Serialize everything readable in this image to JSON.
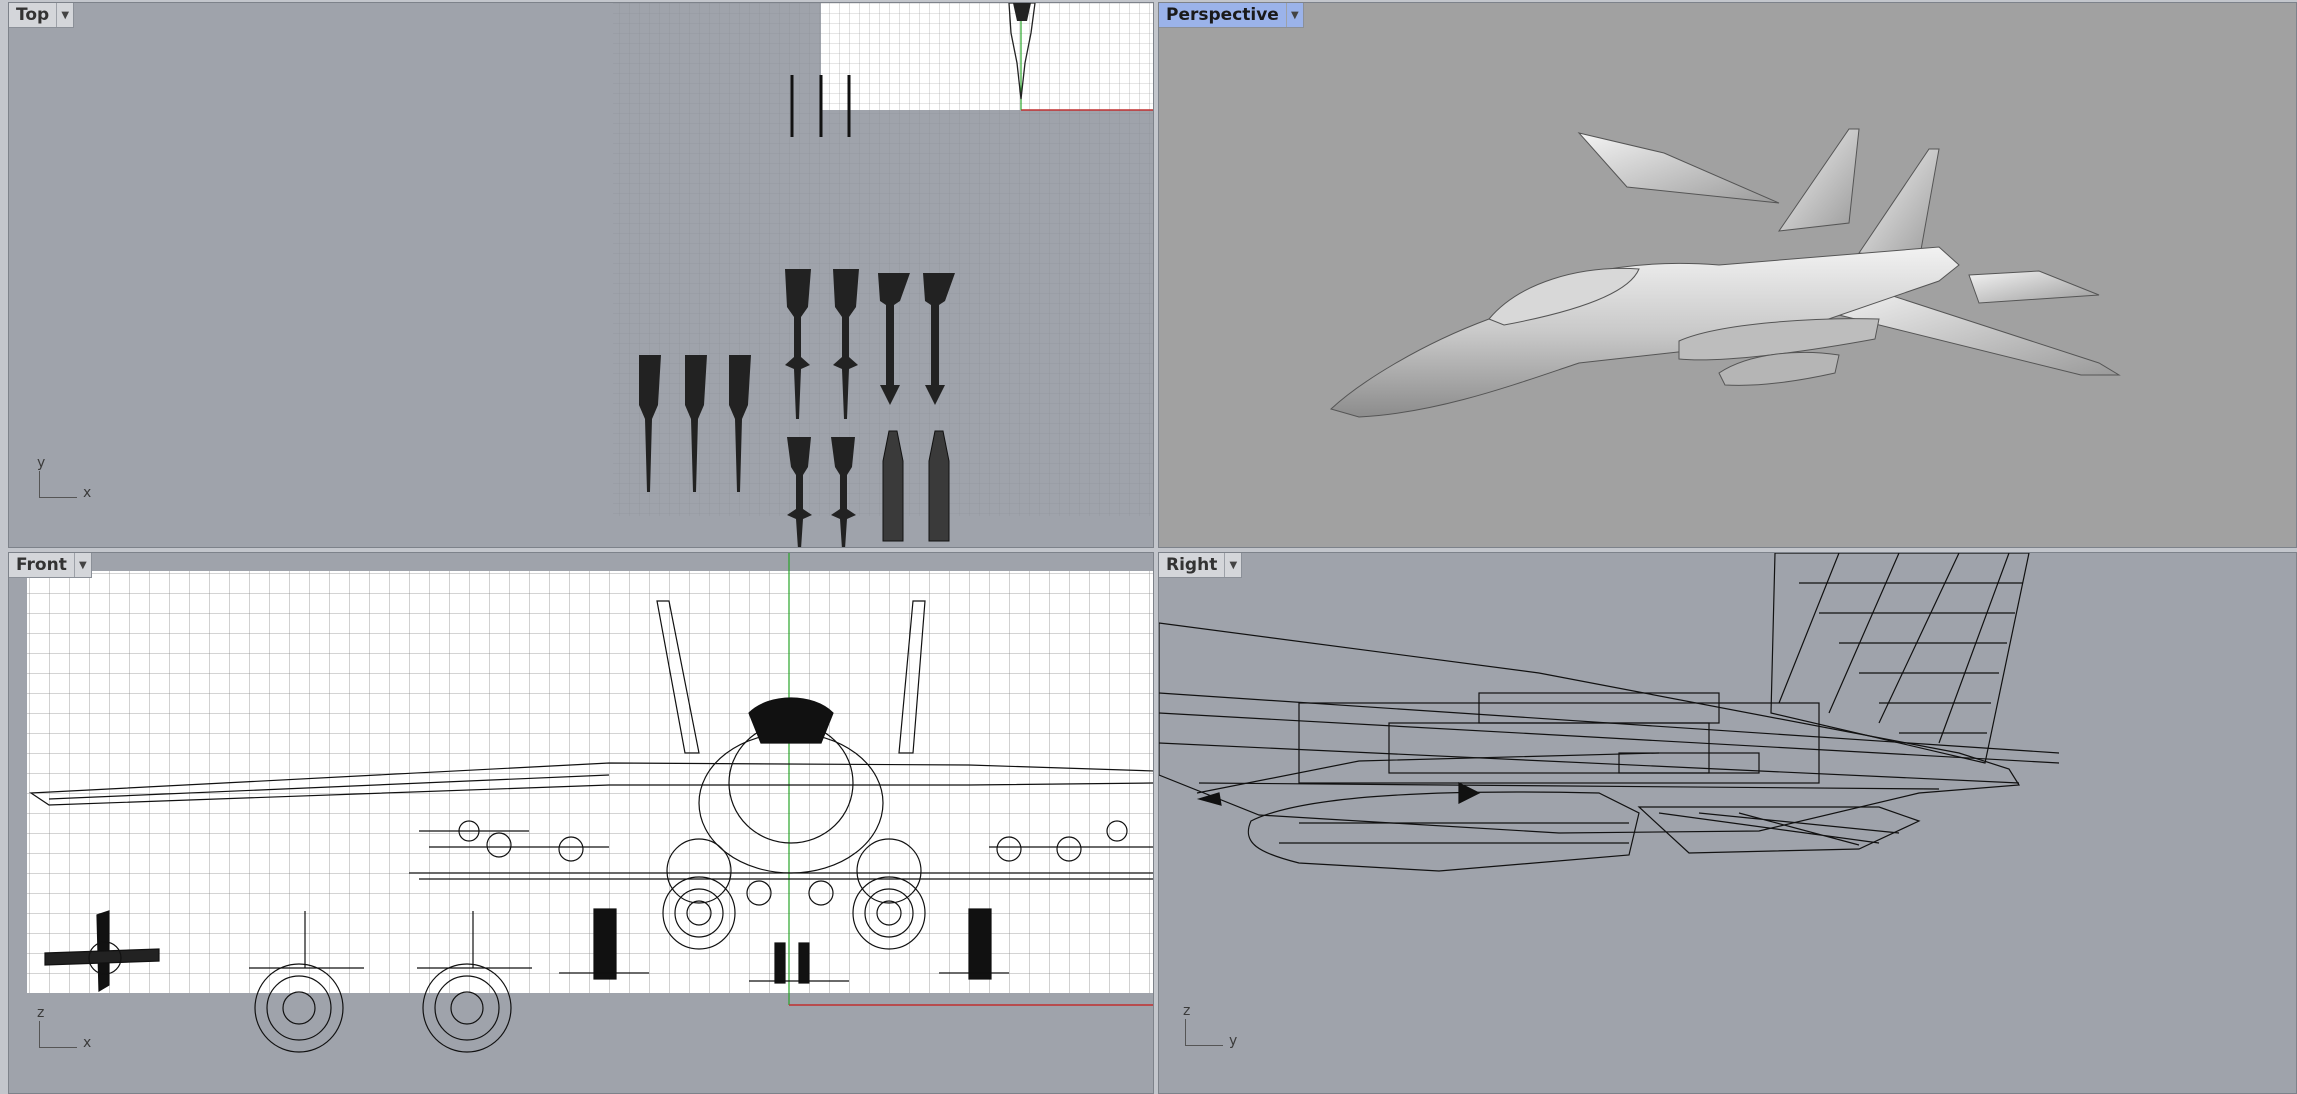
{
  "viewports": {
    "top": {
      "label": "Top",
      "axis_primary": "y",
      "axis_secondary": "x",
      "active": false
    },
    "persp": {
      "label": "Perspective",
      "active": true
    },
    "front": {
      "label": "Front",
      "axis_primary": "z",
      "axis_secondary": "x",
      "active": false
    },
    "right": {
      "label": "Right",
      "axis_primary": "z",
      "axis_secondary": "y",
      "active": false
    }
  },
  "icons": {
    "dropdown": "chevron-down-icon"
  },
  "colors": {
    "viewport_bg": "#9fa3ab",
    "perspective_bg": "#a1a1a1",
    "active_label": "#9bb3ea",
    "grid_major": "#8a8f97",
    "x_axis": "#c03030",
    "y_axis": "#2aa52a"
  }
}
